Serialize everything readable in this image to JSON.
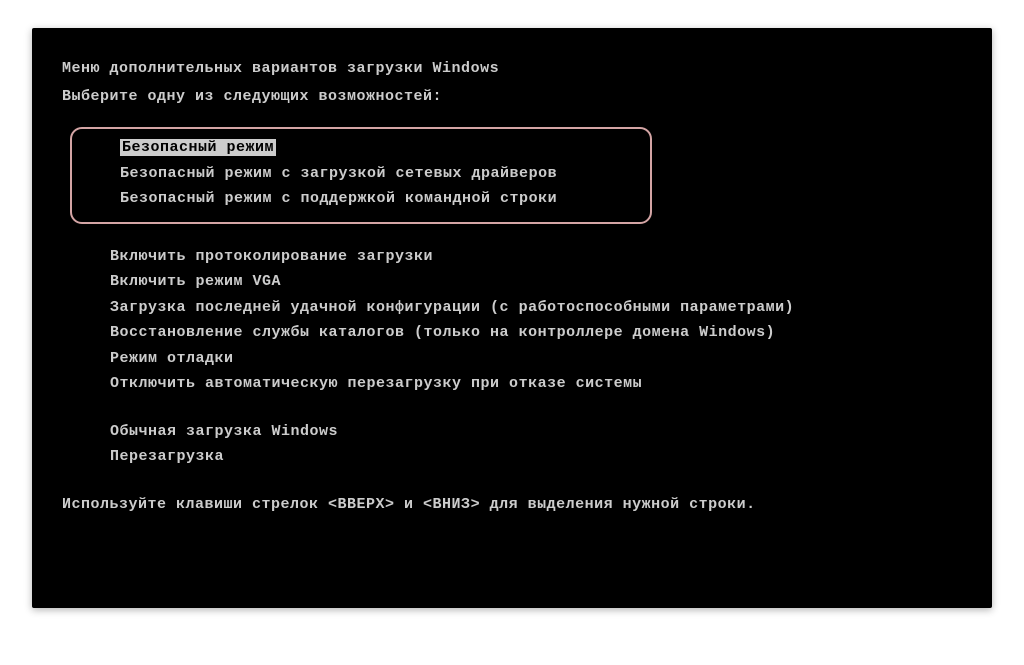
{
  "header": {
    "title": "Меню дополнительных вариантов загрузки Windows",
    "subtitle": "Выберите одну из следующих возможностей:"
  },
  "safeModeGroup": {
    "items": [
      "Безопасный режим",
      "Безопасный режим с загрузкой сетевых драйверов",
      "Безопасный режим с поддержкой командной строки"
    ],
    "selectedIndex": 0
  },
  "optionsGroup": {
    "items": [
      "Включить протоколирование загрузки",
      "Включить режим VGA",
      "Загрузка последней удачной конфигурации (с работоспособными параметрами)",
      "Восстановление службы каталогов (только на контроллере домена Windows)",
      "Режим отладки",
      "Отключить автоматическую перезагрузку при отказе системы"
    ]
  },
  "bootGroup": {
    "items": [
      "Обычная загрузка Windows",
      "Перезагрузка"
    ]
  },
  "footer": {
    "text": "Используйте клавиши стрелок <ВВЕРХ> и <ВНИЗ> для выделения нужной строки."
  }
}
